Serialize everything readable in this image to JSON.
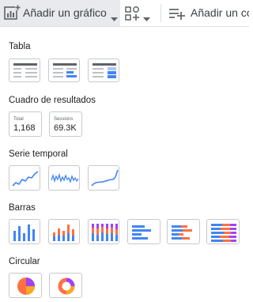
{
  "toolbar": {
    "add_chart_label": "Añadir un gráfico",
    "add_control_label": "Añadir un co",
    "icons": [
      "add-chart-icon",
      "add-control-icon",
      "filter-add-icon",
      "caret-down-icon"
    ]
  },
  "sections": {
    "table": "Tabla",
    "scorecard": "Cuadro de resultados",
    "timeseries": "Serie temporal",
    "bar": "Barras",
    "pie": "Circular"
  },
  "scorecards": [
    {
      "label": "Total",
      "value": "1,168"
    },
    {
      "label": "Sessions",
      "value": "69.3K"
    }
  ],
  "colors": {
    "blue": "#4285f4",
    "orange": "#ff7043",
    "purple": "#a142f4",
    "amber": "#f9a825",
    "dark_gray": "#5f6368",
    "light_gray": "#bdc1c6",
    "button_bg": "#e8eaed"
  }
}
